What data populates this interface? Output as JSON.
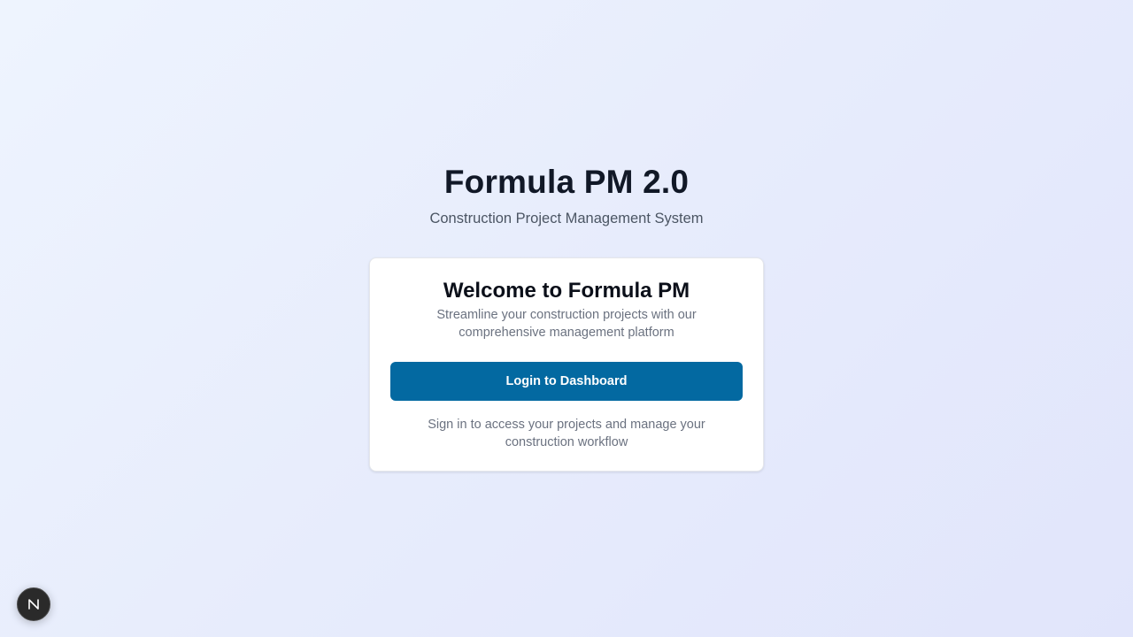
{
  "header": {
    "title": "Formula PM 2.0",
    "subtitle": "Construction Project Management System"
  },
  "card": {
    "title": "Welcome to Formula PM",
    "description": "Streamline your construction projects with our comprehensive management platform",
    "login_button_label": "Login to Dashboard",
    "footer_text": "Sign in to access your projects and manage your construction workflow"
  },
  "dev_badge": {
    "icon": "nextjs-n-icon",
    "letter": "N"
  },
  "colors": {
    "primary": "#0369a1",
    "title_text": "#111827",
    "muted_text": "#6b7280"
  }
}
